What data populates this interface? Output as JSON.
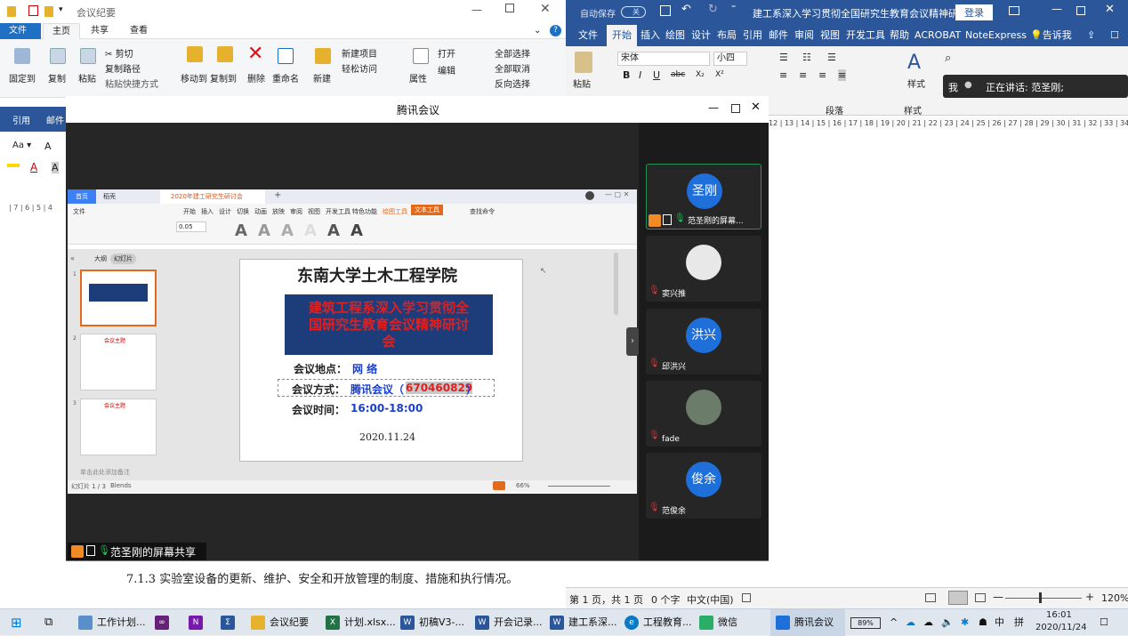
{
  "explorer": {
    "title": "会议纪要",
    "tabs": [
      "文件",
      "主页",
      "共享",
      "查看"
    ],
    "ribbon": {
      "pin": "固定到",
      "copy": "复制",
      "paste": "粘贴",
      "cut": "剪切",
      "copy_path": "复制路径",
      "paste_shortcut": "粘贴快捷方式",
      "move_to": "移动到",
      "copy_to": "复制到",
      "delete": "删除",
      "rename": "重命名",
      "new_folder": "新建",
      "new_item": "新建项目",
      "easy_access": "轻松访问",
      "properties": "属性",
      "open": "打开",
      "edit": "编辑",
      "select_all": "全部选择",
      "select_none": "全部取消",
      "invert": "反向选择"
    }
  },
  "word": {
    "autosave": "自动保存",
    "autosave_state": "关",
    "title": "建工系深入学习贯彻全国研究生教育会议精神研...",
    "login": "登录",
    "tabs": [
      "文件",
      "开始",
      "插入",
      "绘图",
      "设计",
      "布局",
      "引用",
      "邮件",
      "审阅",
      "视图",
      "开发工具",
      "帮助",
      "ACROBAT",
      "NoteExpress",
      "告诉我"
    ],
    "font_name": "宋体",
    "font_size": "小四",
    "group_paragraph": "段落",
    "group_styles": "样式",
    "style_btn": "样式",
    "paste": "粘贴",
    "ruler": "12 | 13 | 14 | 15 | 16 | 17 | 18 | 19 | 20 | 21 | 22 | 23 | 24 | 25 | 26 | 27 | 28 | 29 | 30 | 31 | 32 | 33 | 34 | 35",
    "status": {
      "page": "第 1 页，共 1 页",
      "words": "0 个字",
      "lang": "中文(中国)",
      "zoom": "120%"
    }
  },
  "speaking_banner": {
    "me": "我",
    "text": "正在讲话: 范圣刚;"
  },
  "left_partial": {
    "tab1": "引用",
    "tab2": "邮件",
    "ruler": "| 7 | 6 | 5 | 4"
  },
  "bottom_doc_text": "7.1.3  实验室设备的更新、维护、安全和开放管理的制度、措施和执行情况。",
  "meeting": {
    "title": "腾讯会议",
    "share_label": "范圣刚的屏幕共享",
    "participants": [
      {
        "name": "范圣刚的屏幕...",
        "avatar_text": "圣刚",
        "color": "#1e6fd9"
      },
      {
        "name": "窦兴推",
        "avatar_text": "",
        "color": "#e8e8e8"
      },
      {
        "name": "邱洪兴",
        "avatar_text": "洪兴",
        "color": "#1e6fd9"
      },
      {
        "name": "fade",
        "avatar_text": "",
        "color": "#6b7d6a"
      },
      {
        "name": "范俊余",
        "avatar_text": "俊余",
        "color": "#1e6fd9"
      }
    ]
  },
  "wps": {
    "tab_home": "首页",
    "tab_wps": "稻壳",
    "tab_doc": "2020年建工研究生研讨会",
    "menu": [
      "文件",
      "开始",
      "插入",
      "设计",
      "切换",
      "动画",
      "放映",
      "审阅",
      "视图",
      "开发工具",
      "特色功能",
      "绘图工具",
      "文本工具",
      "查找命令"
    ],
    "font_size": "0.05",
    "panel_outline": "大纲",
    "panel_slides": "幻灯片",
    "notes_hint": "单击此处添加备注",
    "status_left": "幻灯片 1 / 3",
    "status_theme": "Blends",
    "zoom": "66%",
    "thumb2_title": "会议主题",
    "thumb3_title": "会议主题"
  },
  "slide": {
    "school": "东南大学土木工程学院",
    "banner": "建筑工程系深入学习贯彻全国研究生教育会议精神研讨会",
    "place_label": "会议地点：",
    "place_value": "网 络",
    "mode_label": "会议方式：",
    "mode_value": "腾讯会议（",
    "meeting_id": "670460829",
    "mode_close": "）",
    "time_label": "会议时间：",
    "time_value": "16:00-18:00",
    "date": "2020.11.24"
  },
  "taskbar": {
    "items": [
      {
        "label": "工作计划...",
        "color": "#5b8fc9"
      },
      {
        "label": "",
        "color": "#68217a"
      },
      {
        "label": "",
        "color": "#7719aa"
      },
      {
        "label": "",
        "color": "#2b579a"
      },
      {
        "label": "会议纪要",
        "color": "#e6b22e"
      },
      {
        "label": "计划.xlsx...",
        "color": "#217346"
      },
      {
        "label": "初稿V3-...",
        "color": "#2b579a"
      },
      {
        "label": "开会记录...",
        "color": "#2b579a"
      },
      {
        "label": "建工系深...",
        "color": "#2b579a"
      },
      {
        "label": "工程教育...",
        "color": "#0a7ac4"
      },
      {
        "label": "微信",
        "color": "#2aae67"
      },
      {
        "label": "腾讯会议",
        "color": "#1e6fd9"
      }
    ],
    "battery": "89%",
    "ime": "中",
    "time": "16:01",
    "date": "2020/11/24"
  }
}
